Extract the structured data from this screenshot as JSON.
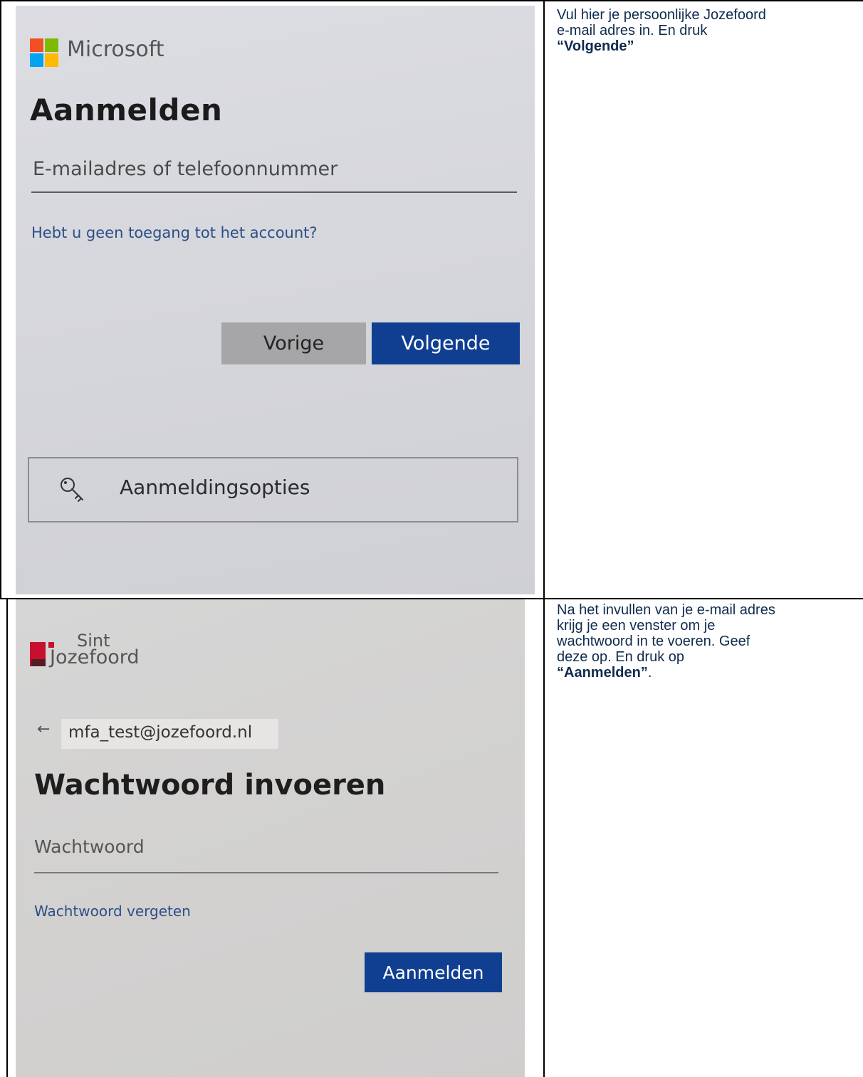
{
  "rows": [
    {
      "screenshot": {
        "brand": "Microsoft",
        "heading": "Aanmelden",
        "field_placeholder": "E-mailadres of telefoonnummer",
        "help_link": "Hebt u geen toegang tot het account?",
        "back_button": "Vorige",
        "next_button": "Volgende",
        "options_label": "Aanmeldingsopties",
        "options_icon": "key-icon",
        "logo_colors": [
          "#f25022",
          "#7fba00",
          "#00a4ef",
          "#ffb900"
        ]
      },
      "instruction": {
        "line1": "Vul hier je persoonlijke Jozefoord",
        "line2": "e-mail adres in. En druk",
        "emphasis": "“Volgende”"
      }
    },
    {
      "screenshot": {
        "brand_top": "Sint",
        "brand_bottom": "Jozefoord",
        "back_icon": "arrow-left-icon",
        "email": "mfa_test@jozefoord.nl",
        "heading": "Wachtwoord invoeren",
        "field_placeholder": "Wachtwoord",
        "help_link": "Wachtwoord vergeten",
        "submit_button": "Aanmelden",
        "logo_color": "#c8102e"
      },
      "instruction": {
        "line1": "Na het invullen van je e-mail adres",
        "line2": "krijg je een venster om je",
        "line3": "wachtwoord in te voeren. Geef",
        "line4": "deze op. En druk op",
        "emphasis": "“Aanmelden”",
        "trailing": "."
      }
    }
  ],
  "colors": {
    "instruction_text": "#0f2b4d",
    "primary_button": "#103f91",
    "secondary_button": "#a6a6a8",
    "link": "#2b4f86"
  }
}
